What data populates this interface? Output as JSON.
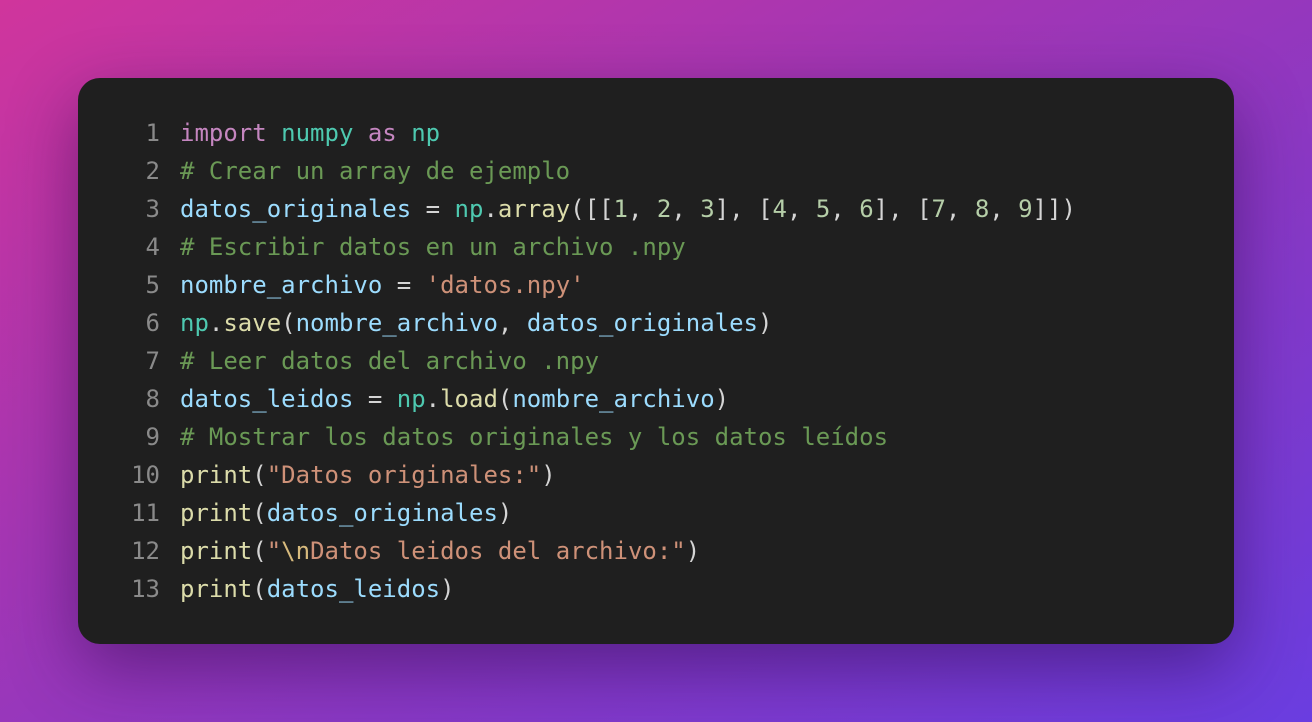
{
  "colors": {
    "keyword": "#c586c0",
    "module": "#4ec9b0",
    "comment": "#6a9955",
    "variable": "#9cdcfe",
    "function": "#dcdcaa",
    "string": "#ce9178",
    "escape": "#d7ba7d",
    "number": "#b5cea8",
    "punct": "#d4d4d4",
    "plain": "#d4d4d4"
  },
  "lines": [
    {
      "number": "1",
      "tokens": [
        {
          "t": "import",
          "c": "keyword"
        },
        {
          "t": " ",
          "c": "plain"
        },
        {
          "t": "numpy",
          "c": "module"
        },
        {
          "t": " ",
          "c": "plain"
        },
        {
          "t": "as",
          "c": "keyword"
        },
        {
          "t": " ",
          "c": "plain"
        },
        {
          "t": "np",
          "c": "module"
        }
      ]
    },
    {
      "number": "2",
      "tokens": [
        {
          "t": "# Crear un array de ejemplo",
          "c": "comment"
        }
      ]
    },
    {
      "number": "3",
      "tokens": [
        {
          "t": "datos_originales",
          "c": "variable"
        },
        {
          "t": " = ",
          "c": "plain"
        },
        {
          "t": "np",
          "c": "module"
        },
        {
          "t": ".",
          "c": "punct"
        },
        {
          "t": "array",
          "c": "function"
        },
        {
          "t": "([[",
          "c": "punct"
        },
        {
          "t": "1",
          "c": "number"
        },
        {
          "t": ", ",
          "c": "punct"
        },
        {
          "t": "2",
          "c": "number"
        },
        {
          "t": ", ",
          "c": "punct"
        },
        {
          "t": "3",
          "c": "number"
        },
        {
          "t": "], [",
          "c": "punct"
        },
        {
          "t": "4",
          "c": "number"
        },
        {
          "t": ", ",
          "c": "punct"
        },
        {
          "t": "5",
          "c": "number"
        },
        {
          "t": ", ",
          "c": "punct"
        },
        {
          "t": "6",
          "c": "number"
        },
        {
          "t": "], [",
          "c": "punct"
        },
        {
          "t": "7",
          "c": "number"
        },
        {
          "t": ", ",
          "c": "punct"
        },
        {
          "t": "8",
          "c": "number"
        },
        {
          "t": ", ",
          "c": "punct"
        },
        {
          "t": "9",
          "c": "number"
        },
        {
          "t": "]])",
          "c": "punct"
        }
      ]
    },
    {
      "number": "4",
      "tokens": [
        {
          "t": "# Escribir datos en un archivo .npy",
          "c": "comment"
        }
      ]
    },
    {
      "number": "5",
      "tokens": [
        {
          "t": "nombre_archivo",
          "c": "variable"
        },
        {
          "t": " = ",
          "c": "plain"
        },
        {
          "t": "'datos.npy'",
          "c": "string"
        }
      ]
    },
    {
      "number": "6",
      "tokens": [
        {
          "t": "np",
          "c": "module"
        },
        {
          "t": ".",
          "c": "punct"
        },
        {
          "t": "save",
          "c": "function"
        },
        {
          "t": "(",
          "c": "punct"
        },
        {
          "t": "nombre_archivo",
          "c": "variable"
        },
        {
          "t": ", ",
          "c": "punct"
        },
        {
          "t": "datos_originales",
          "c": "variable"
        },
        {
          "t": ")",
          "c": "punct"
        }
      ]
    },
    {
      "number": "7",
      "tokens": [
        {
          "t": "# Leer datos del archivo .npy",
          "c": "comment"
        }
      ]
    },
    {
      "number": "8",
      "tokens": [
        {
          "t": "datos_leidos",
          "c": "variable"
        },
        {
          "t": " = ",
          "c": "plain"
        },
        {
          "t": "np",
          "c": "module"
        },
        {
          "t": ".",
          "c": "punct"
        },
        {
          "t": "load",
          "c": "function"
        },
        {
          "t": "(",
          "c": "punct"
        },
        {
          "t": "nombre_archivo",
          "c": "variable"
        },
        {
          "t": ")",
          "c": "punct"
        }
      ]
    },
    {
      "number": "9",
      "tokens": [
        {
          "t": "# Mostrar los datos originales y los datos leídos",
          "c": "comment"
        }
      ]
    },
    {
      "number": "10",
      "tokens": [
        {
          "t": "print",
          "c": "function"
        },
        {
          "t": "(",
          "c": "punct"
        },
        {
          "t": "\"Datos originales:\"",
          "c": "string"
        },
        {
          "t": ")",
          "c": "punct"
        }
      ]
    },
    {
      "number": "11",
      "tokens": [
        {
          "t": "print",
          "c": "function"
        },
        {
          "t": "(",
          "c": "punct"
        },
        {
          "t": "datos_originales",
          "c": "variable"
        },
        {
          "t": ")",
          "c": "punct"
        }
      ]
    },
    {
      "number": "12",
      "tokens": [
        {
          "t": "print",
          "c": "function"
        },
        {
          "t": "(",
          "c": "punct"
        },
        {
          "t": "\"",
          "c": "string"
        },
        {
          "t": "\\n",
          "c": "escape"
        },
        {
          "t": "Datos leidos del archivo:\"",
          "c": "string"
        },
        {
          "t": ")",
          "c": "punct"
        }
      ]
    },
    {
      "number": "13",
      "tokens": [
        {
          "t": "print",
          "c": "function"
        },
        {
          "t": "(",
          "c": "punct"
        },
        {
          "t": "datos_leidos",
          "c": "variable"
        },
        {
          "t": ")",
          "c": "punct"
        }
      ]
    }
  ]
}
